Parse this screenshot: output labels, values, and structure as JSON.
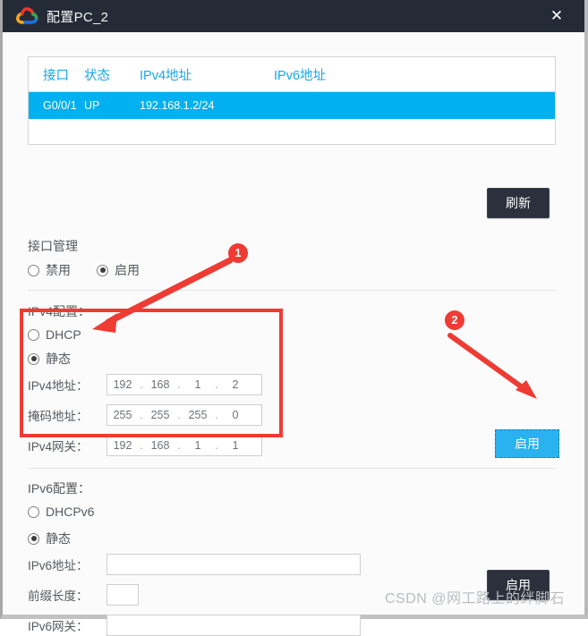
{
  "window": {
    "title": "配置PC_2",
    "logo_icon": "cloud-logo-icon",
    "close_label": "✕"
  },
  "interface_table": {
    "columns": [
      "接口",
      "状态",
      "IPv4地址",
      "IPv6地址"
    ],
    "rows": [
      {
        "interface": "G0/0/1",
        "state": "UP",
        "ipv4": "192.168.1.2/24",
        "ipv6": "",
        "selected": true
      }
    ]
  },
  "buttons": {
    "refresh": "刷新",
    "apply_ipv4": "启用",
    "apply_ipv6": "启用"
  },
  "interface_mgmt": {
    "title": "接口管理",
    "options": [
      {
        "label": "禁用",
        "selected": false
      },
      {
        "label": "启用",
        "selected": true
      }
    ]
  },
  "ipv4": {
    "title": "IPv4配置：",
    "mode_options": [
      {
        "label": "DHCP",
        "selected": false
      },
      {
        "label": "静态",
        "selected": true
      }
    ],
    "fields": [
      {
        "label": "IPv4地址：",
        "octets": [
          "192",
          "168",
          "1",
          "2"
        ]
      },
      {
        "label": "掩码地址：",
        "octets": [
          "255",
          "255",
          "255",
          "0"
        ]
      },
      {
        "label": "IPv4网关：",
        "octets": [
          "192",
          "168",
          "1",
          "1"
        ]
      }
    ]
  },
  "ipv6": {
    "title": "IPv6配置：",
    "mode_options": [
      {
        "label": "DHCPv6",
        "selected": false
      },
      {
        "label": "静态",
        "selected": true
      }
    ],
    "fields": [
      {
        "label": "IPv6地址：",
        "value": ""
      },
      {
        "label": "前缀长度：",
        "value": ""
      },
      {
        "label": "IPv6网关：",
        "value": ""
      }
    ]
  },
  "annotations": {
    "marker_1": "1",
    "marker_2": "2",
    "highlight_color": "#ee3b33"
  },
  "watermark": "CSDN @网工路上的绊脚石"
}
